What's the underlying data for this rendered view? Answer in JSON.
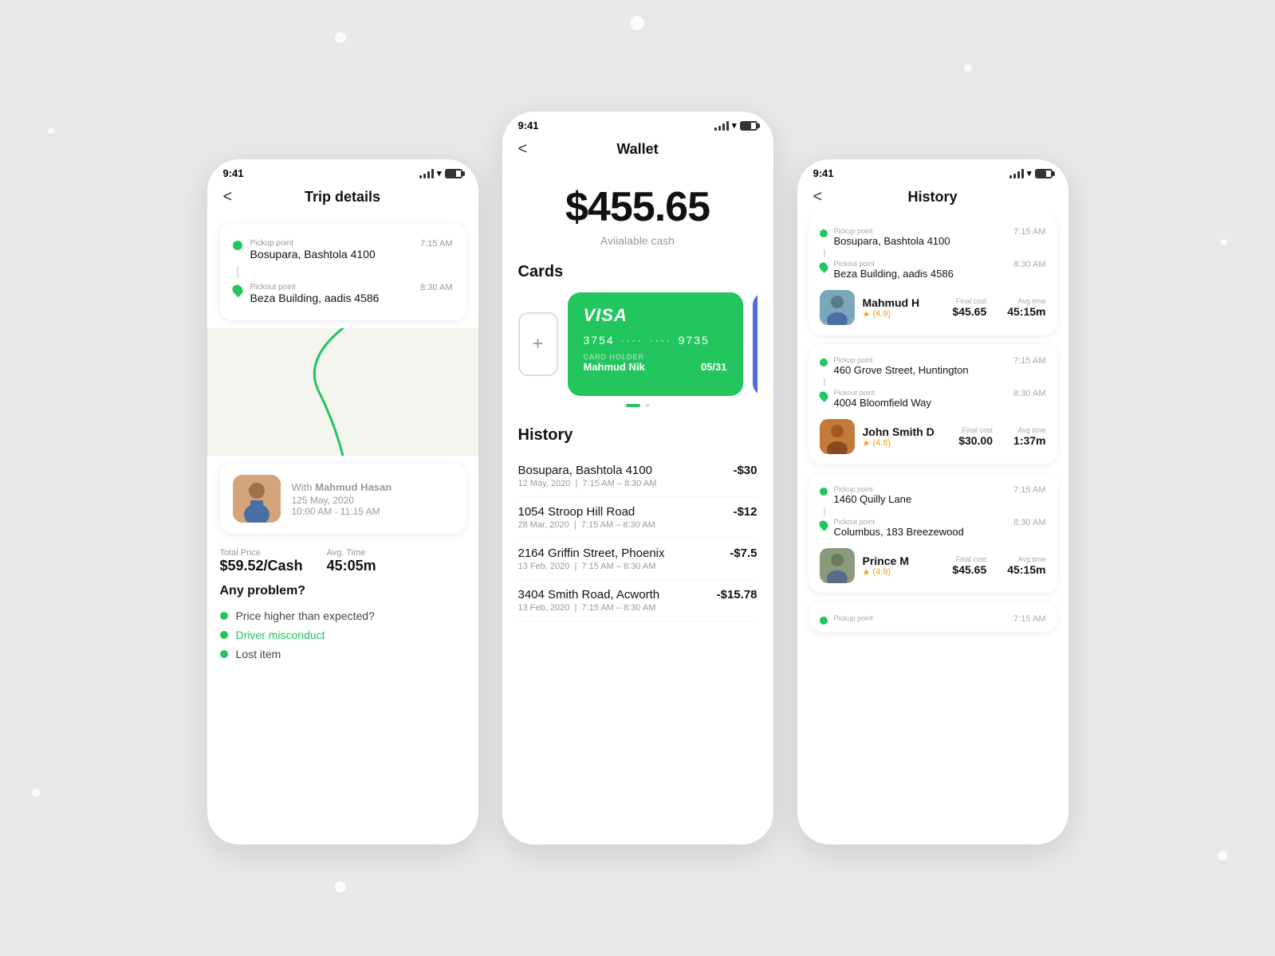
{
  "background": {
    "color": "#e0e0e0"
  },
  "left_phone": {
    "status_time": "9:41",
    "title": "Trip details",
    "back": "<",
    "trip": {
      "pickup_label": "Pickup point",
      "pickup_name": "Bosupara, Bashtola 4100",
      "pickup_time": "7:15 AM",
      "pickout_label": "Pickout point",
      "pickout_name": "Beza Building, aadis 4586",
      "pickout_time": "8:30 AM"
    },
    "driver": {
      "with_label": "With",
      "name": "Mahmud Hasan",
      "date": "125 May, 2020",
      "time_range": "10:00 AM - 11:15 AM"
    },
    "stats": {
      "total_price_label": "Total Price",
      "total_price": "$59.52/Cash",
      "avg_time_label": "Avg. Time",
      "avg_time": "45:05m"
    },
    "problems": {
      "title": "Any problem?",
      "items": [
        {
          "text": "Price higher than expected?",
          "active": false
        },
        {
          "text": "Driver misconduct",
          "active": true
        },
        {
          "text": "Lost item",
          "active": false
        }
      ]
    }
  },
  "center_phone": {
    "status_time": "9:41",
    "title": "Wallet",
    "back": "<",
    "balance": "$455.65",
    "balance_label": "Aviialable cash",
    "cards_title": "Cards",
    "add_card_label": "+",
    "card": {
      "brand": "VISA",
      "number_start": "3754",
      "dots1": "····",
      "dots2": "····",
      "number_end": "9735",
      "holder_label": "CARD HOLDER",
      "holder_name": "Mahmud Nik",
      "expiry": "05/31"
    },
    "history_title": "History",
    "history_items": [
      {
        "address": "Bosupara, Bashtola 4100",
        "amount": "-$30",
        "date": "12 May, 2020",
        "time_range": "7:15 AM – 8:30 AM"
      },
      {
        "address": "1054  Stroop Hill Road",
        "amount": "-$12",
        "date": "28 Mar, 2020",
        "time_range": "7:15 AM – 8:30 AM"
      },
      {
        "address": "2164  Griffin Street, Phoenix",
        "amount": "-$7.5",
        "date": "13 Feb, 2020",
        "time_range": "7:15 AM – 8:30 AM"
      },
      {
        "address": "3404  Smith Road, Acworth",
        "amount": "-$15.78",
        "date": "13 Feb, 2020",
        "time_range": "7:15 AM – 8:30 AM"
      }
    ]
  },
  "right_phone": {
    "status_time": "9:41",
    "title": "History",
    "back": "<",
    "trips": [
      {
        "pickup_label": "Pickup point",
        "pickup_name": "Bosupara, Bashtola 4100",
        "pickup_time": "7:15 AM",
        "pickout_label": "Pickout point",
        "pickout_name": "Beza Building, aadis 4586",
        "pickout_time": "8:30 AM",
        "driver_name": "Mahmud H",
        "driver_rating": "4.9",
        "final_cost_label": "Final cost",
        "final_cost": "$45.65",
        "avg_time_label": "Avg time",
        "avg_time": "45:15m",
        "avatar_color": "#7ba7bc"
      },
      {
        "pickup_label": "Pickup point",
        "pickup_name": "460  Grove Street, Huntington",
        "pickup_time": "7:15 AM",
        "pickout_label": "Pickout point",
        "pickout_name": "4004  Bloomfield Way",
        "pickout_time": "8:30 AM",
        "driver_name": "John Smith D",
        "driver_rating": "4.8",
        "final_cost_label": "Final cost",
        "final_cost": "$30.00",
        "avg_time_label": "Avg time",
        "avg_time": "1:37m",
        "avatar_color": "#c47a3a"
      },
      {
        "pickup_label": "Pickup point",
        "pickup_name": "1460  Quilly Lane",
        "pickup_time": "7:15 AM",
        "pickout_label": "Pickout point",
        "pickout_name": "Columbus, 183  Breezewood",
        "pickout_time": "8:30 AM",
        "driver_name": "Prince M",
        "driver_rating": "4.9",
        "final_cost_label": "Final cost",
        "final_cost": "$45.65",
        "avg_time_label": "Avg time",
        "avg_time": "45:15m",
        "avatar_color": "#8a6a5a"
      },
      {
        "pickup_label": "Pickup point",
        "pickup_name": "",
        "pickup_time": "7:15 AM",
        "pickout_label": "",
        "pickout_name": "",
        "pickout_time": ""
      }
    ]
  }
}
